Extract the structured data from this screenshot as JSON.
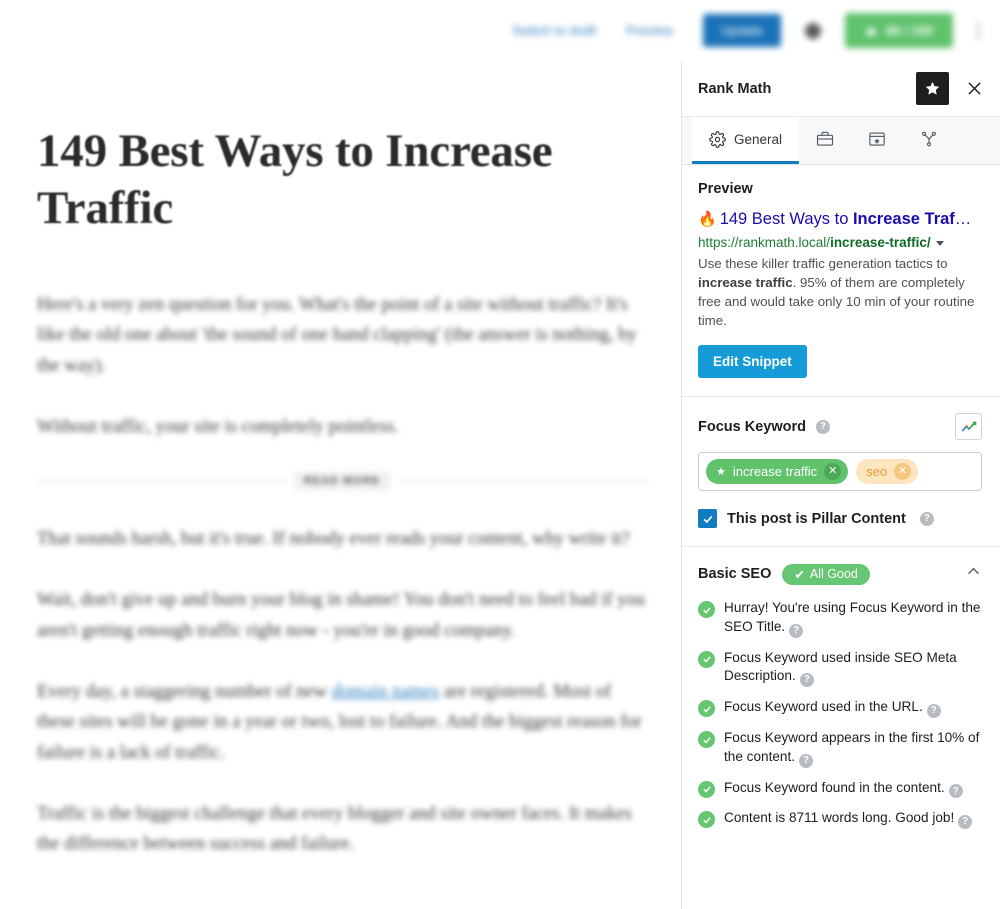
{
  "toolbar": {
    "switch_to_draft": "Switch to draft",
    "preview": "Preview",
    "update": "Update",
    "seo_score": "86 / 100",
    "options_icon": "kebab-menu-icon"
  },
  "editor": {
    "title": "149 Best Ways to Increase Traffic",
    "read_more_label": "READ MORE",
    "paragraphs": [
      "Here's a very zen question for you. What's the point of a site without traffic? It's like the old one about 'the sound of one hand clapping' (the answer is nothing, by the way).",
      "Without traffic, your site is completely pointless.",
      "That sounds harsh, but it's true. If nobody ever reads your content, why write it?",
      "Wait, don't give up and burn your blog in shame! You don't need to feel bad if you aren't getting enough traffic right now - you're in good company."
    ],
    "paragraph_with_link": {
      "before": "Every day, a staggering number of new ",
      "link": "domain names",
      "after": " are registered. Most of these sites will be gone in a year or two, lost to failure. And the biggest reason for failure is a lack of traffic."
    },
    "last_paragraph": "Traffic is the biggest challenge that every blogger and site owner faces. It makes the difference between success and failure."
  },
  "panel": {
    "title": "Rank Math",
    "star_icon": "star-icon",
    "close_icon": "close-icon",
    "tabs": [
      {
        "label": "General",
        "icon": "gear-icon",
        "active": true
      },
      {
        "label": "",
        "icon": "briefcase-icon",
        "active": false
      },
      {
        "label": "",
        "icon": "schema-browser-star-icon",
        "active": false
      },
      {
        "label": "",
        "icon": "social-share-icon",
        "active": false
      }
    ],
    "preview": {
      "heading": "Preview",
      "fire_emoji": "🔥",
      "title_plain": "149 Best Ways to ",
      "title_bold": "Increase Traf",
      "title_ellipsis": "…",
      "url_base": "https://rankmath.local/",
      "url_slug": "increase-traffic/",
      "description_part1": "Use these killer traffic generation tactics to ",
      "description_bold": "increase traffic",
      "description_part2": ". 95% of them are completely free and would take only 10 min of your routine time.",
      "edit_snippet_label": "Edit Snippet"
    },
    "focus_keyword": {
      "heading": "Focus Keyword",
      "help_icon": "help-icon",
      "trends_icon": "google-trends-icon",
      "keywords": [
        {
          "label": "increase traffic",
          "primary": true
        },
        {
          "label": "seo",
          "primary": false
        }
      ],
      "pillar_label": "This post is Pillar Content",
      "pillar_checked": true
    },
    "basic_seo": {
      "heading": "Basic SEO",
      "badge": "All Good",
      "collapse_icon": "chevron-up-icon",
      "checks": [
        "Hurray! You're using Focus Keyword in the SEO Title.",
        "Focus Keyword used inside SEO Meta Description.",
        "Focus Keyword used in the URL.",
        "Focus Keyword appears in the first 10% of the content.",
        "Focus Keyword found in the content.",
        "Content is 8711 words long. Good job!"
      ]
    }
  },
  "colors": {
    "accent_blue": "#117dc1",
    "update_blue": "#1a72b8",
    "snippet_blue": "#159bd7",
    "green": "#67c672",
    "keyword_green": "#60c36b",
    "keyword_orange": "#fde5c0",
    "link_blue": "#1a0dab",
    "url_green": "#1e7b34"
  }
}
